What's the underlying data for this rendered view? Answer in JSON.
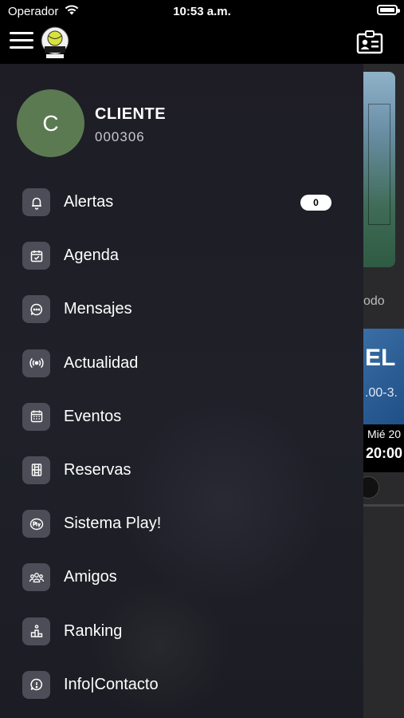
{
  "status_bar": {
    "carrier": "Operador",
    "time": "10:53 a.m."
  },
  "profile": {
    "initial": "C",
    "name": "CLIENTE",
    "id": "000306"
  },
  "menu": [
    {
      "label": "Alertas",
      "icon": "bell-icon",
      "badge": "0"
    },
    {
      "label": "Agenda",
      "icon": "calendar-check-icon"
    },
    {
      "label": "Mensajes",
      "icon": "chat-bubble-icon"
    },
    {
      "label": "Actualidad",
      "icon": "broadcast-icon"
    },
    {
      "label": "Eventos",
      "icon": "calendar-grid-icon"
    },
    {
      "label": "Reservas",
      "icon": "court-icon"
    },
    {
      "label": "Sistema Play!",
      "icon": "play-logo-icon"
    },
    {
      "label": "Amigos",
      "icon": "friends-icon"
    },
    {
      "label": "Ranking",
      "icon": "podium-icon"
    },
    {
      "label": "Info|Contacto",
      "icon": "info-chat-icon"
    }
  ],
  "background": {
    "section_text": "odo",
    "banner_text": "EL",
    "banner_subtext": ".00-3.",
    "date_text": "Mié 20",
    "time_text": "20:00"
  },
  "colors": {
    "avatar": "#5c7a52",
    "drawer": "#1e1d26",
    "icon_box": "#4d4d57"
  }
}
